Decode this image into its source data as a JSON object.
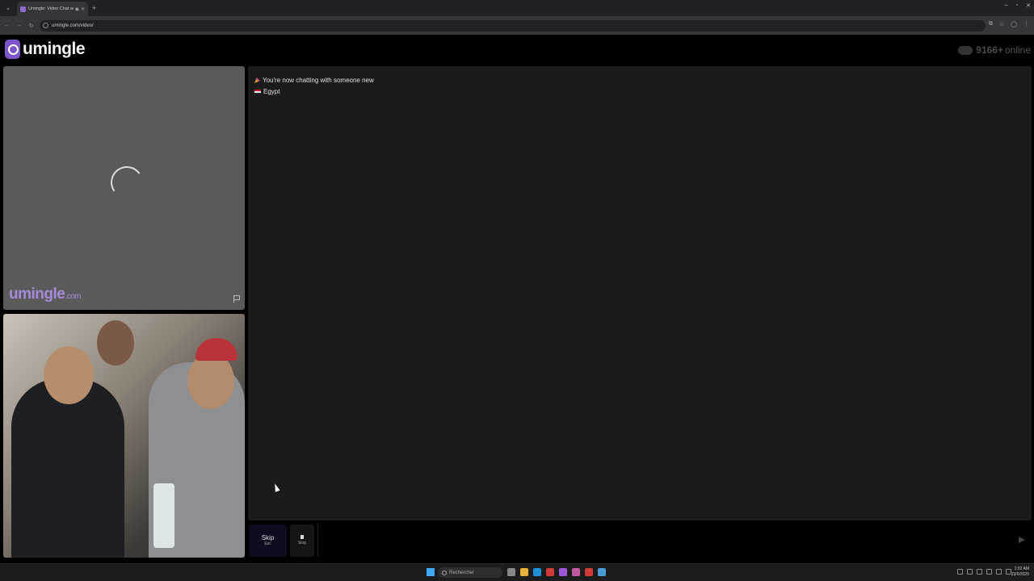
{
  "browser": {
    "tab_title": "Umingle: Video Chat with S",
    "url": "umingle.com/video/",
    "window_controls": [
      "–",
      "▫",
      "✕"
    ]
  },
  "header": {
    "logo_text": "umingle",
    "online_count": "9166+",
    "online_label": "online"
  },
  "video_top": {
    "watermark": "umingle",
    "watermark_suffix": ".com"
  },
  "chat": {
    "system_message": "You're now chatting with someone new",
    "country": "Egypt"
  },
  "controls": {
    "skip_label": "Skip",
    "skip_key": "Esc",
    "stop_label": "Stop",
    "message_placeholder": ""
  },
  "taskbar": {
    "search_placeholder": "Rechercher",
    "time": "1:02 AM",
    "date": "23/6/2025",
    "app_colors": [
      "#888888",
      "#e8b23a",
      "#1e90d8",
      "#d23a3a",
      "#9a58d8",
      "#c05aa0",
      "#d03a3a",
      "#4a9ad8"
    ]
  },
  "colors": {
    "brand": "#7d54c9",
    "chat_bg": "#1b1b1b",
    "skip_bg": "#0c0c1e"
  }
}
